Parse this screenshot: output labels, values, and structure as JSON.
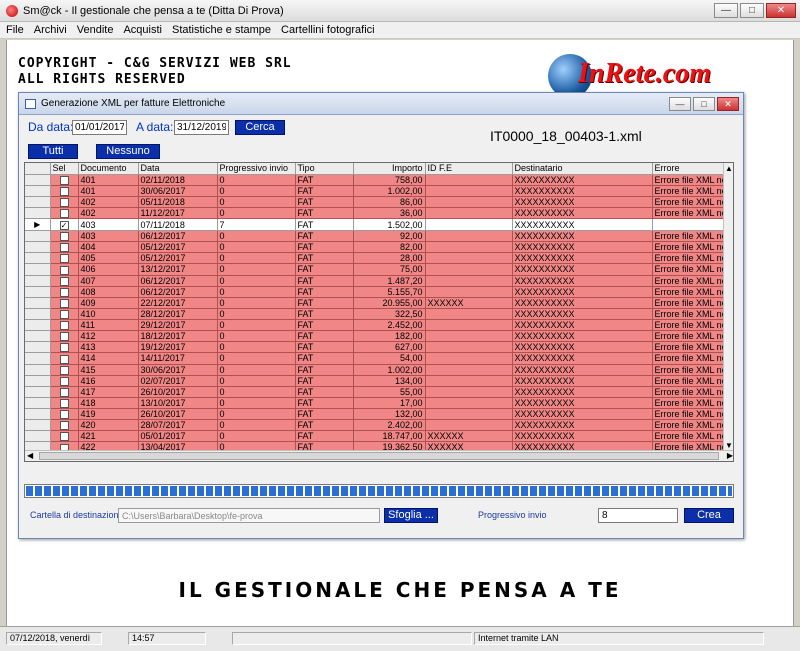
{
  "window": {
    "title": "Sm@ck - Il gestionale che pensa a te (Ditta Di Prova)"
  },
  "menu": [
    "File",
    "Archivi",
    "Vendite",
    "Acquisti",
    "Statistiche e stampe",
    "Cartellini fotografici"
  ],
  "background": {
    "copyright_line1": "COPYRIGHT - C&G SERVIZI WEB SRL",
    "copyright_line2": "ALL RIGHTS RESERVED",
    "logo_text": "InRete.com",
    "slogan": "IL GESTIONALE CHE PENSA A TE"
  },
  "dialog": {
    "title": "Generazione XML per fatture Elettroniche",
    "from_label": "Da data:",
    "from_value": "01/01/2017",
    "to_label": "A data:",
    "to_value": "31/12/2019",
    "search_button": "Cerca",
    "all_button": "Tutti",
    "none_button": "Nessuno",
    "filename": "IT0000_18_00403-1.xml",
    "columns": [
      "Sel",
      "Documento",
      "Data",
      "Progressivo invio",
      "Tipo",
      "Importo",
      "ID F.E",
      "Destinatario",
      "Errore"
    ],
    "rows": [
      {
        "doc": "401",
        "data": "02/11/2018",
        "prog": "0",
        "tipo": "FAT",
        "importo": "758,00",
        "idfe": "",
        "dest": "XXXXXXXXXX",
        "err": "Errore file XML non",
        "checked": false,
        "selected": false
      },
      {
        "doc": "401",
        "data": "30/06/2017",
        "prog": "0",
        "tipo": "FAT",
        "importo": "1.002,00",
        "idfe": "",
        "dest": "XXXXXXXXXX",
        "err": "Errore file XML non",
        "checked": false,
        "selected": false
      },
      {
        "doc": "402",
        "data": "05/11/2018",
        "prog": "0",
        "tipo": "FAT",
        "importo": "86,00",
        "idfe": "",
        "dest": "XXXXXXXXXX",
        "err": "Errore file XML non",
        "checked": false,
        "selected": false
      },
      {
        "doc": "402",
        "data": "11/12/2017",
        "prog": "0",
        "tipo": "FAT",
        "importo": "36,00",
        "idfe": "",
        "dest": "XXXXXXXXXX",
        "err": "Errore file XML non",
        "checked": false,
        "selected": false
      },
      {
        "doc": "403",
        "data": "07/11/2018",
        "prog": "7",
        "tipo": "FAT",
        "importo": "1.502,00",
        "idfe": "",
        "dest": "XXXXXXXXXX",
        "err": "",
        "checked": true,
        "selected": true
      },
      {
        "doc": "403",
        "data": "06/12/2017",
        "prog": "0",
        "tipo": "FAT",
        "importo": "92,00",
        "idfe": "",
        "dest": "XXXXXXXXXX",
        "err": "Errore file XML non",
        "checked": false,
        "selected": false
      },
      {
        "doc": "404",
        "data": "05/12/2017",
        "prog": "0",
        "tipo": "FAT",
        "importo": "82,00",
        "idfe": "",
        "dest": "XXXXXXXXXX",
        "err": "Errore file XML non",
        "checked": false,
        "selected": false
      },
      {
        "doc": "405",
        "data": "05/12/2017",
        "prog": "0",
        "tipo": "FAT",
        "importo": "28,00",
        "idfe": "",
        "dest": "XXXXXXXXXX",
        "err": "Errore file XML non",
        "checked": false,
        "selected": false
      },
      {
        "doc": "406",
        "data": "13/12/2017",
        "prog": "0",
        "tipo": "FAT",
        "importo": "75,00",
        "idfe": "",
        "dest": "XXXXXXXXXX",
        "err": "Errore file XML non",
        "checked": false,
        "selected": false
      },
      {
        "doc": "407",
        "data": "06/12/2017",
        "prog": "0",
        "tipo": "FAT",
        "importo": "1.487,20",
        "idfe": "",
        "dest": "XXXXXXXXXX",
        "err": "Errore file XML non",
        "checked": false,
        "selected": false
      },
      {
        "doc": "408",
        "data": "06/12/2017",
        "prog": "0",
        "tipo": "FAT",
        "importo": "5.155,70",
        "idfe": "",
        "dest": "XXXXXXXXXX",
        "err": "Errore file XML non",
        "checked": false,
        "selected": false
      },
      {
        "doc": "409",
        "data": "22/12/2017",
        "prog": "0",
        "tipo": "FAT",
        "importo": "20.955,00",
        "idfe": "XXXXXX",
        "dest": "XXXXXXXXXX",
        "err": "Errore file XML non",
        "checked": false,
        "selected": false
      },
      {
        "doc": "410",
        "data": "28/12/2017",
        "prog": "0",
        "tipo": "FAT",
        "importo": "322,50",
        "idfe": "",
        "dest": "XXXXXXXXXX",
        "err": "Errore file XML non",
        "checked": false,
        "selected": false
      },
      {
        "doc": "411",
        "data": "29/12/2017",
        "prog": "0",
        "tipo": "FAT",
        "importo": "2.452,00",
        "idfe": "",
        "dest": "XXXXXXXXXX",
        "err": "Errore file XML non",
        "checked": false,
        "selected": false
      },
      {
        "doc": "412",
        "data": "18/12/2017",
        "prog": "0",
        "tipo": "FAT",
        "importo": "182,00",
        "idfe": "",
        "dest": "XXXXXXXXXX",
        "err": "Errore file XML non",
        "checked": false,
        "selected": false
      },
      {
        "doc": "413",
        "data": "19/12/2017",
        "prog": "0",
        "tipo": "FAT",
        "importo": "627,00",
        "idfe": "",
        "dest": "XXXXXXXXXX",
        "err": "Errore file XML non",
        "checked": false,
        "selected": false
      },
      {
        "doc": "414",
        "data": "14/11/2017",
        "prog": "0",
        "tipo": "FAT",
        "importo": "54,00",
        "idfe": "",
        "dest": "XXXXXXXXXX",
        "err": "Errore file XML non",
        "checked": false,
        "selected": false
      },
      {
        "doc": "415",
        "data": "30/06/2017",
        "prog": "0",
        "tipo": "FAT",
        "importo": "1.002,00",
        "idfe": "",
        "dest": "XXXXXXXXXX",
        "err": "Errore file XML non",
        "checked": false,
        "selected": false
      },
      {
        "doc": "416",
        "data": "02/07/2017",
        "prog": "0",
        "tipo": "FAT",
        "importo": "134,00",
        "idfe": "",
        "dest": "XXXXXXXXXX",
        "err": "Errore file XML non",
        "checked": false,
        "selected": false
      },
      {
        "doc": "417",
        "data": "26/10/2017",
        "prog": "0",
        "tipo": "FAT",
        "importo": "55,00",
        "idfe": "",
        "dest": "XXXXXXXXXX",
        "err": "Errore file XML non",
        "checked": false,
        "selected": false
      },
      {
        "doc": "418",
        "data": "13/10/2017",
        "prog": "0",
        "tipo": "FAT",
        "importo": "17,00",
        "idfe": "",
        "dest": "XXXXXXXXXX",
        "err": "Errore file XML non",
        "checked": false,
        "selected": false
      },
      {
        "doc": "419",
        "data": "26/10/2017",
        "prog": "0",
        "tipo": "FAT",
        "importo": "132,00",
        "idfe": "",
        "dest": "XXXXXXXXXX",
        "err": "Errore file XML non",
        "checked": false,
        "selected": false
      },
      {
        "doc": "420",
        "data": "28/07/2017",
        "prog": "0",
        "tipo": "FAT",
        "importo": "2.402,00",
        "idfe": "",
        "dest": "XXXXXXXXXX",
        "err": "Errore file XML non",
        "checked": false,
        "selected": false
      },
      {
        "doc": "421",
        "data": "05/01/2017",
        "prog": "0",
        "tipo": "FAT",
        "importo": "18.747,00",
        "idfe": "XXXXXX",
        "dest": "XXXXXXXXXX",
        "err": "Errore file XML non",
        "checked": false,
        "selected": false
      },
      {
        "doc": "422",
        "data": "13/04/2017",
        "prog": "0",
        "tipo": "FAT",
        "importo": "19.362,50",
        "idfe": "XXXXXX",
        "dest": "XXXXXXXXXX",
        "err": "Errore file XML non",
        "checked": false,
        "selected": false
      }
    ],
    "progress_fraction": 1.0,
    "dest_folder_label": "Cartella di destinazione",
    "dest_folder_value": "C:\\Users\\Barbara\\Desktop\\fe-prova",
    "browse_button": "Sfoglia ...",
    "progressive_label": "Progressivo invio",
    "progressive_value": "8",
    "create_button": "Crea"
  },
  "status": {
    "date": "07/12/2018, venerdì",
    "time": "14:57",
    "connection": "Internet tramite LAN"
  },
  "colors": {
    "error_row": "#f08686",
    "button_blue": "#0b2fa8",
    "label_blue": "#0033cc"
  }
}
